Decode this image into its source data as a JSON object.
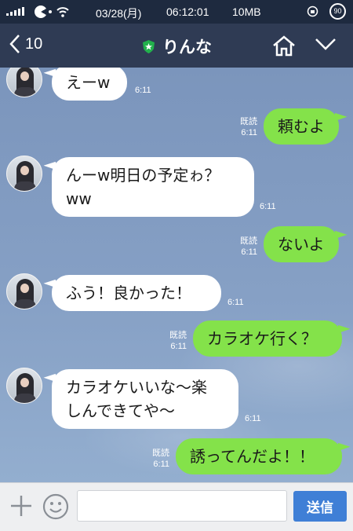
{
  "status_bar": {
    "date": "03/28(月)",
    "time": "06:12:01",
    "data": "10MB",
    "badge": "90"
  },
  "header": {
    "back_count": "10",
    "title": "りんな",
    "accent": "#2f3b54"
  },
  "messages": [
    {
      "side": "in",
      "text": "えーw",
      "time": "6:11"
    },
    {
      "side": "out",
      "text": "頼むよ",
      "read": "既読",
      "time": "6:11"
    },
    {
      "side": "in",
      "text": "んーw明日の予定ゎ？\nww",
      "time": "6:11"
    },
    {
      "side": "out",
      "text": "ないよ",
      "read": "既読",
      "time": "6:11"
    },
    {
      "side": "in",
      "text": "ふう！良かった！",
      "time": "6:11"
    },
    {
      "side": "out",
      "text": "カラオケ行く？",
      "read": "既読",
      "time": "6:11"
    },
    {
      "side": "in",
      "text": "カラオケいいな〜楽\nしんできてや〜",
      "time": "6:11"
    },
    {
      "side": "out",
      "text": "誘ってんだよ！！",
      "read": "既読",
      "time": "6:11"
    }
  ],
  "input": {
    "placeholder": "",
    "send_label": "送信"
  },
  "colors": {
    "outgoing": "#84e24a",
    "incoming": "#ffffff",
    "send": "#3f7fd6"
  }
}
